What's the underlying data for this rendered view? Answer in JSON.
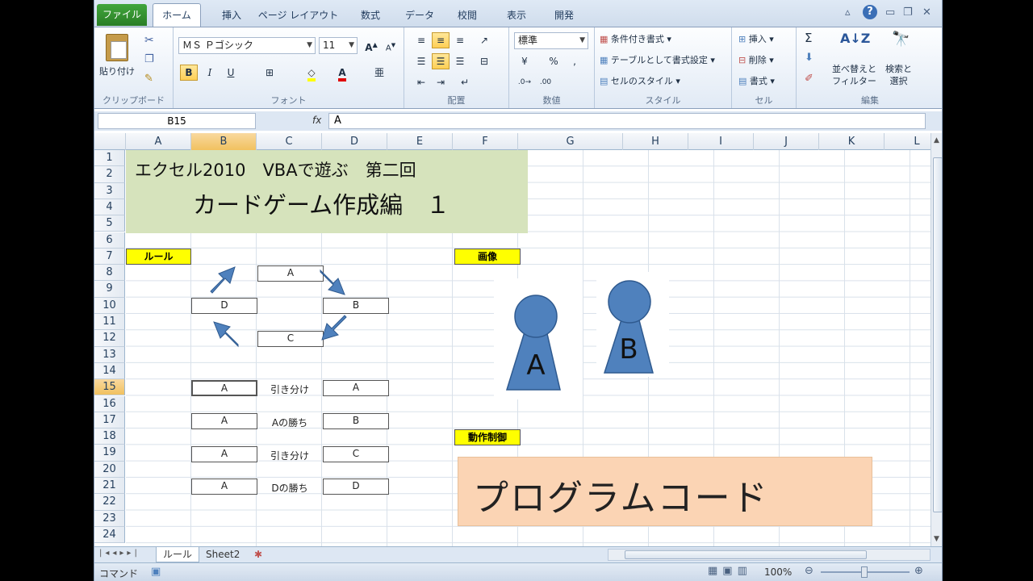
{
  "tabs": [
    "ファイル",
    "ホーム",
    "挿入",
    "ページ レイアウト",
    "数式",
    "データ",
    "校閲",
    "表示",
    "開発"
  ],
  "ribbon": {
    "clipboard": {
      "paste": "貼り付け",
      "label": "クリップボード"
    },
    "font": {
      "name": "ＭＳ Ｐゴシック",
      "size": "11",
      "bold": "B",
      "italic": "I",
      "underline": "U",
      "label": "フォント"
    },
    "alignment": {
      "label": "配置"
    },
    "number": {
      "format": "標準",
      "percent": "%",
      "label": "数値"
    },
    "styles": {
      "conditional": "条件付き書式",
      "table": "テーブルとして書式設定",
      "cell": "セルのスタイル",
      "label": "スタイル"
    },
    "cells": {
      "insert": "挿入",
      "delete": "削除",
      "format": "書式",
      "label": "セル"
    },
    "editing": {
      "sum": "Σ",
      "sort": "並べ替えと\nフィルター",
      "find": "検索と\n選択",
      "label": "編集"
    }
  },
  "formula": {
    "namebox": "B15",
    "fx": "fx",
    "value": "A"
  },
  "columns": [
    "A",
    "B",
    "C",
    "D",
    "E",
    "F",
    "G",
    "H",
    "I",
    "J",
    "K",
    "L"
  ],
  "rows": [
    "1",
    "2",
    "3",
    "4",
    "5",
    "6",
    "7",
    "8",
    "9",
    "10",
    "11",
    "12",
    "13",
    "14",
    "15",
    "16",
    "17",
    "18",
    "19",
    "20",
    "21",
    "22",
    "23",
    "24"
  ],
  "sheet": {
    "title1": "エクセル2010　VBAで遊ぶ　第二回",
    "title2": "カードゲーム作成編　１",
    "rule_label": "ルール",
    "image_label": "画像",
    "control_label": "動作制御",
    "cycle": {
      "top": "A",
      "right": "B",
      "bottom": "C",
      "left": "D"
    },
    "results": [
      {
        "left": "A",
        "result": "引き分け",
        "right": "A"
      },
      {
        "left": "A",
        "result": "Aの勝ち",
        "right": "B"
      },
      {
        "left": "A",
        "result": "引き分け",
        "right": "C"
      },
      {
        "left": "A",
        "result": "Dの勝ち",
        "right": "D"
      }
    ],
    "piece_a": "A",
    "piece_b": "B",
    "code_text": "プログラムコード"
  },
  "sheet_tabs": [
    "ルール",
    "Sheet2"
  ],
  "status": {
    "mode": "コマンド",
    "zoom": "100%"
  },
  "colors": {
    "accent": "#4f81bd",
    "title_bg": "#d6e3bc",
    "label_bg": "#ffff00",
    "code_bg": "#fbd4b4"
  }
}
